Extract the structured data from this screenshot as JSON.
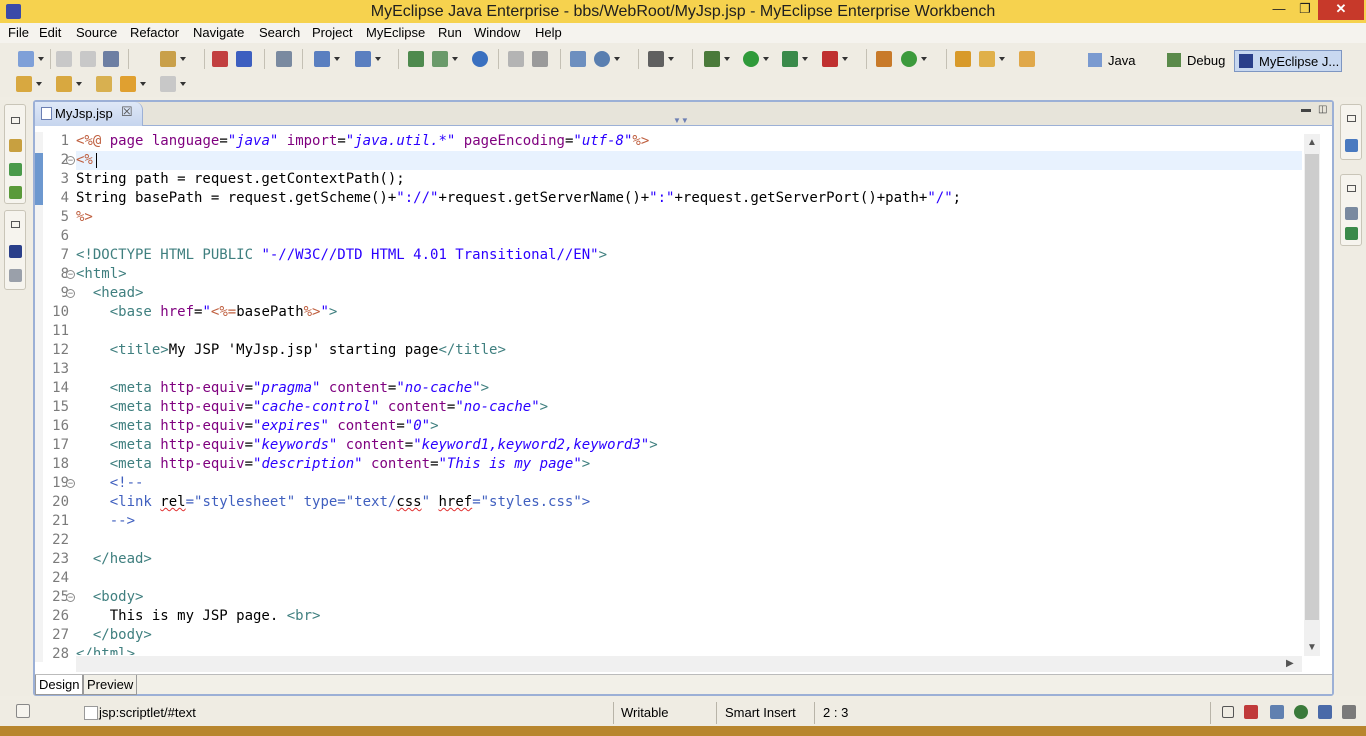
{
  "window": {
    "title": "MyEclipse Java Enterprise - bbs/WebRoot/MyJsp.jsp - MyEclipse Enterprise Workbench",
    "minimize": "—",
    "maximize": "❐",
    "close": "✕"
  },
  "menu": [
    "File",
    "Edit",
    "Source",
    "Refactor",
    "Navigate",
    "Search",
    "Project",
    "MyEclipse",
    "Run",
    "Window",
    "Help"
  ],
  "perspectives": [
    {
      "label": "Java",
      "icon": "java-perspective-icon"
    },
    {
      "label": "Debug",
      "icon": "debug-perspective-icon"
    },
    {
      "label": "MyEclipse J...",
      "icon": "myeclipse-perspective-icon",
      "active": true
    }
  ],
  "editor": {
    "tab_label": "MyJsp.jsp",
    "tab_close": "☒",
    "current_line": 2,
    "lines": [
      [
        [
          "jsp",
          "<%@ "
        ],
        [
          "att",
          "page "
        ],
        [
          "att",
          "language"
        ],
        [
          "",
          "="
        ],
        [
          "val",
          "\"java\""
        ],
        [
          "",
          " "
        ],
        [
          "att",
          "import"
        ],
        [
          "",
          "="
        ],
        [
          "val",
          "\"java.util.*\""
        ],
        [
          "",
          " "
        ],
        [
          "att",
          "pageEncoding"
        ],
        [
          "",
          "="
        ],
        [
          "val",
          "\"utf-8\""
        ],
        [
          "jsp",
          "%>"
        ]
      ],
      [
        [
          "jsp",
          "<%"
        ]
      ],
      [
        [
          "",
          "String path = request.getContextPath();"
        ]
      ],
      [
        [
          "",
          "String basePath = request.getScheme()+"
        ],
        [
          "str",
          "\"://\""
        ],
        [
          "",
          "+request.getServerName()+"
        ],
        [
          "str",
          "\":\""
        ],
        [
          "",
          "+request.getServerPort()+path+"
        ],
        [
          "str",
          "\"/\""
        ],
        [
          "",
          ";"
        ]
      ],
      [
        [
          "jsp",
          "%>"
        ]
      ],
      [],
      [
        [
          "dt",
          "<!DOCTYPE HTML PUBLIC "
        ],
        [
          "str",
          "\"-//W3C//DTD HTML 4.01 Transitional//EN\""
        ],
        [
          "dt",
          ">"
        ]
      ],
      [
        [
          "tag",
          "<html>"
        ]
      ],
      [
        [
          "",
          "  "
        ],
        [
          "tag",
          "<head>"
        ]
      ],
      [
        [
          "",
          "    "
        ],
        [
          "tag",
          "<base "
        ],
        [
          "att",
          "href"
        ],
        [
          "",
          "="
        ],
        [
          "str",
          "\""
        ],
        [
          "jsp",
          "<%="
        ],
        [
          "",
          "basePath"
        ],
        [
          "jsp",
          "%>"
        ],
        [
          "str",
          "\""
        ],
        [
          "tag",
          ">"
        ]
      ],
      [],
      [
        [
          "",
          "    "
        ],
        [
          "tag",
          "<title>"
        ],
        [
          "",
          "My JSP 'MyJsp.jsp' starting page"
        ],
        [
          "tag",
          "</title>"
        ]
      ],
      [],
      [
        [
          "",
          "    "
        ],
        [
          "tag",
          "<meta "
        ],
        [
          "att",
          "http-equiv"
        ],
        [
          "",
          "="
        ],
        [
          "val",
          "\"pragma\""
        ],
        [
          "",
          " "
        ],
        [
          "att",
          "content"
        ],
        [
          "",
          "="
        ],
        [
          "val",
          "\"no-cache\""
        ],
        [
          "tag",
          ">"
        ]
      ],
      [
        [
          "",
          "    "
        ],
        [
          "tag",
          "<meta "
        ],
        [
          "att",
          "http-equiv"
        ],
        [
          "",
          "="
        ],
        [
          "val",
          "\"cache-control\""
        ],
        [
          "",
          " "
        ],
        [
          "att",
          "content"
        ],
        [
          "",
          "="
        ],
        [
          "val",
          "\"no-cache\""
        ],
        [
          "tag",
          ">"
        ]
      ],
      [
        [
          "",
          "    "
        ],
        [
          "tag",
          "<meta "
        ],
        [
          "att",
          "http-equiv"
        ],
        [
          "",
          "="
        ],
        [
          "val",
          "\"expires\""
        ],
        [
          "",
          " "
        ],
        [
          "att",
          "content"
        ],
        [
          "",
          "="
        ],
        [
          "val",
          "\"0\""
        ],
        [
          "tag",
          ">"
        ]
      ],
      [
        [
          "",
          "    "
        ],
        [
          "tag",
          "<meta "
        ],
        [
          "att",
          "http-equiv"
        ],
        [
          "",
          "="
        ],
        [
          "val",
          "\"keywords\""
        ],
        [
          "",
          " "
        ],
        [
          "att",
          "content"
        ],
        [
          "",
          "="
        ],
        [
          "val",
          "\"keyword1,keyword2,keyword3\""
        ],
        [
          "tag",
          ">"
        ]
      ],
      [
        [
          "",
          "    "
        ],
        [
          "tag",
          "<meta "
        ],
        [
          "att",
          "http-equiv"
        ],
        [
          "",
          "="
        ],
        [
          "val",
          "\"description\""
        ],
        [
          "",
          " "
        ],
        [
          "att",
          "content"
        ],
        [
          "",
          "="
        ],
        [
          "val",
          "\"This is my page\""
        ],
        [
          "tag",
          ">"
        ]
      ],
      [
        [
          "",
          "    "
        ],
        [
          "cmt",
          "<!--"
        ]
      ],
      [
        [
          "",
          "    "
        ],
        [
          "cmt",
          "<link "
        ],
        [
          "squig",
          "rel"
        ],
        [
          "cmt",
          "=\"stylesheet\" type=\"text/"
        ],
        [
          "squig",
          "css"
        ],
        [
          "cmt",
          "\" "
        ],
        [
          "squig",
          "href"
        ],
        [
          "cmt",
          "=\"styles.css\">"
        ]
      ],
      [
        [
          "",
          "    "
        ],
        [
          "cmt",
          "-->"
        ]
      ],
      [],
      [
        [
          "",
          "  "
        ],
        [
          "tag",
          "</head>"
        ]
      ],
      [],
      [
        [
          "",
          "  "
        ],
        [
          "tag",
          "<body>"
        ]
      ],
      [
        [
          "",
          "    This is my JSP page. "
        ],
        [
          "tag",
          "<br>"
        ]
      ],
      [
        [
          "",
          "  "
        ],
        [
          "tag",
          "</body>"
        ]
      ],
      [
        [
          "tag",
          "</html>"
        ]
      ]
    ],
    "fold_lines": [
      2,
      8,
      9,
      19,
      25
    ],
    "bottom_tabs": [
      "Design",
      "Preview"
    ]
  },
  "status": {
    "path": "jsp:scriptlet/#text",
    "mode": "Writable",
    "insert": "Smart Insert",
    "position": "2 : 3"
  },
  "colors": {
    "titlebar": "#f6d24e",
    "accent_border": "#9cb0d6",
    "jsp_delim": "#bf5f3f",
    "tag": "#3f7f7f",
    "attribute": "#7f007f",
    "string": "#2a00ff",
    "comment": "#3f5fbf"
  }
}
